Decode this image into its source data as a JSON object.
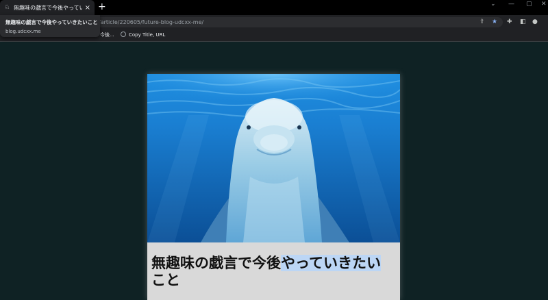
{
  "browser": {
    "tab_title": "無趣味の戯言で今後やっていきたいこと",
    "new_tab": "+",
    "close": "×",
    "address": "blog.udcxx.me/article/220605/future-blog-udcxx-me/",
    "address_visible": "/article/220605/future-blog-udcxx-me/",
    "window_controls": [
      "⌄",
      "—",
      "▢",
      "✕"
    ]
  },
  "hovercard": {
    "title": "無趣味の戯言で今後やっていきたいこと",
    "domain": "blog.udcxx.me"
  },
  "bookmarks": [
    {
      "label": "今後..."
    },
    {
      "label": "Copy Title, URL"
    }
  ],
  "article": {
    "title_part1": "無趣味の戯言で今後",
    "title_highlight": "やっていきたい",
    "title_part2": "こと",
    "hero_image_alt": "dolphin"
  },
  "colors": {
    "page_bg": "#0f2224",
    "chrome_bg": "#202124",
    "highlight": "#bcd6f5",
    "star": "#8ab4f8"
  }
}
